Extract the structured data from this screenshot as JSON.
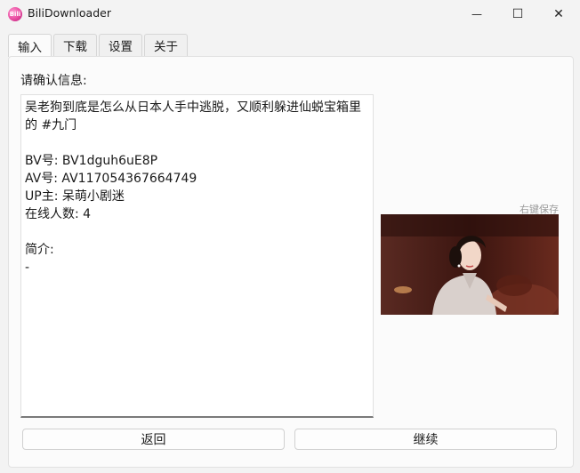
{
  "window": {
    "title": "BiliDownloader",
    "icon_text": "Bili",
    "minimize_glyph": "—",
    "maximize_glyph": "☐",
    "close_glyph": "✕"
  },
  "tabs": [
    {
      "label": "输入",
      "active": true
    },
    {
      "label": "下载",
      "active": false
    },
    {
      "label": "设置",
      "active": false
    },
    {
      "label": "关于",
      "active": false
    }
  ],
  "main": {
    "confirm_label": "请确认信息:",
    "info_text": "吴老狗到底是怎么从日本人手中逃脱，又顺利躲进仙蜕宝箱里的 #九门\n\nBV号: BV1dguh6uE8P\nAV号: AV117054367664749\nUP主: 呆萌小剧迷\n在线人数: 4\n\n简介:\n-",
    "save_hint": "右键保存"
  },
  "buttons": {
    "back": "返回",
    "continue": "继续"
  },
  "colors": {
    "accent_icon": "#e84aa0",
    "background": "#f3f3f3"
  }
}
